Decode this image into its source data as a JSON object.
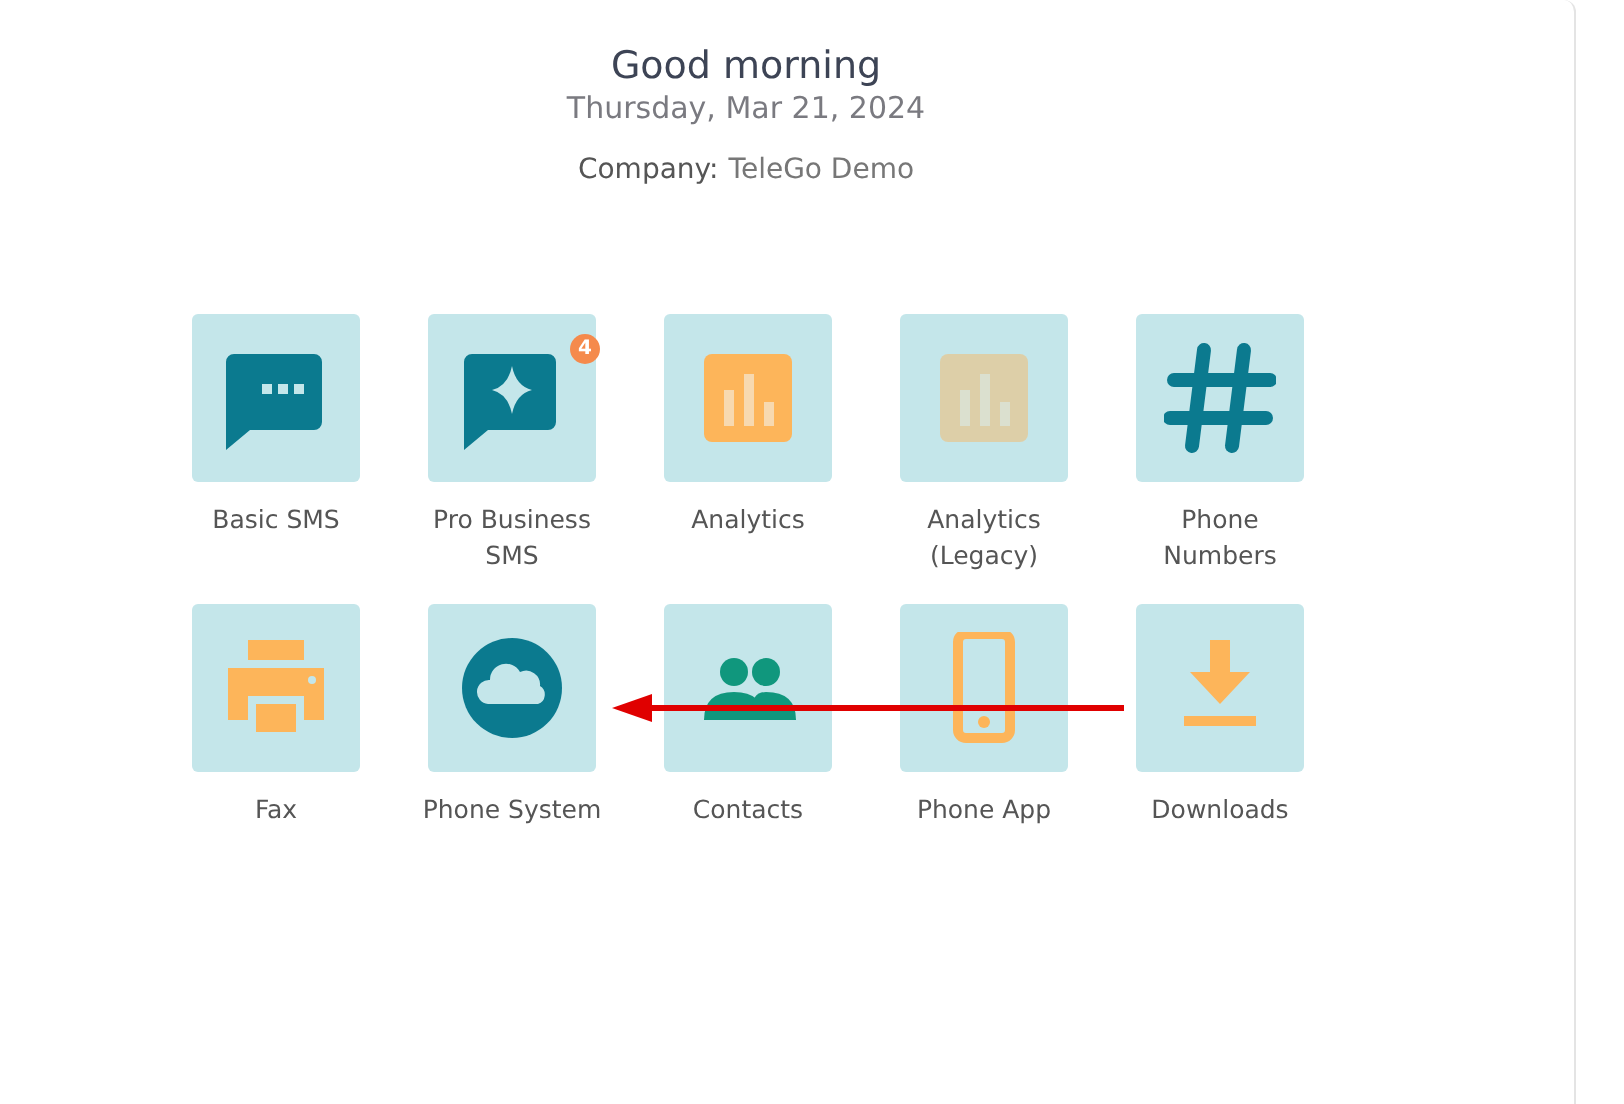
{
  "greeting": "Good morning",
  "date": "Thursday, Mar 21, 2024",
  "company": {
    "label": "Company:",
    "name": "TeleGo Demo"
  },
  "apps": [
    {
      "label": "Basic SMS",
      "dimmed": false
    },
    {
      "label": "Pro Business SMS",
      "dimmed": false,
      "badge": "4"
    },
    {
      "label": "Analytics",
      "dimmed": false
    },
    {
      "label": "Analytics (Legacy)",
      "dimmed": true
    },
    {
      "label": "Phone Numbers",
      "dimmed": false
    },
    {
      "label": "Fax",
      "dimmed": false
    },
    {
      "label": "Phone System",
      "dimmed": false
    },
    {
      "label": "Contacts",
      "dimmed": false
    },
    {
      "label": "Phone App",
      "dimmed": false
    },
    {
      "label": "Downloads",
      "dimmed": false
    }
  ]
}
